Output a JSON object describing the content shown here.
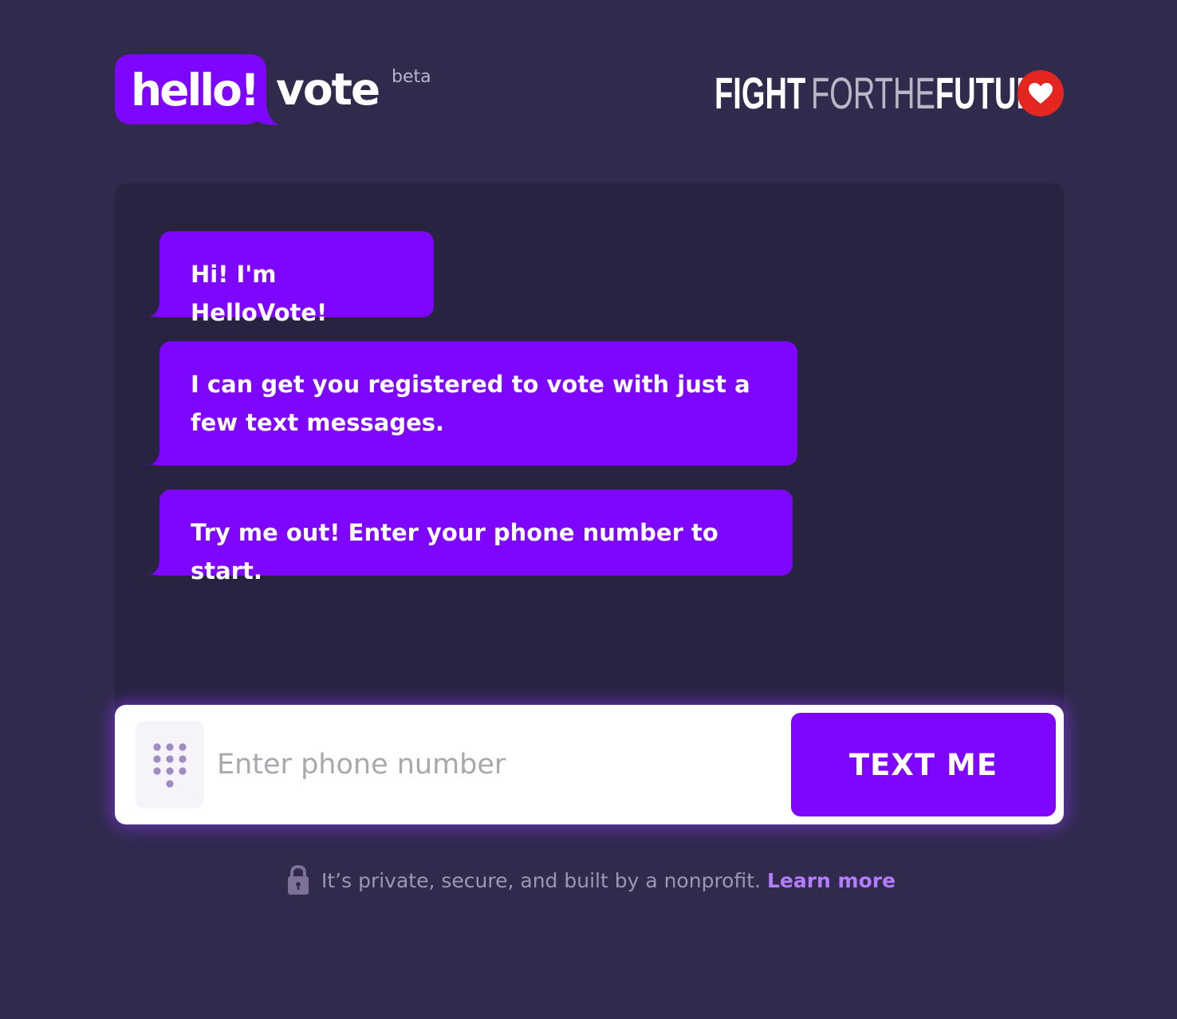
{
  "header": {
    "logo_hello": "hello!",
    "logo_vote": "vote",
    "logo_badge": "beta",
    "partner": {
      "word1": "FIGHT",
      "word2": "FORTHE",
      "word3": "FUTURE",
      "icon": "heart-icon"
    }
  },
  "chat": {
    "messages": [
      {
        "text": "Hi! I'm HelloVote!"
      },
      {
        "text": "I can get you registered to vote with just a few text messages."
      },
      {
        "text": "Try me out! Enter your phone number to start."
      }
    ]
  },
  "signup": {
    "keypad_icon": "keypad-icon",
    "phone_placeholder": "Enter phone number",
    "phone_value": "",
    "submit_label": "TEXT ME"
  },
  "footer": {
    "lock_icon": "lock-icon",
    "privacy_text": "It’s private, secure, and built by a nonprofit.",
    "learn_more": "Learn more"
  },
  "colors": {
    "page_background": "#302a4d",
    "chat_background": "#272341",
    "accent_purple": "#7e05fe",
    "link_purple": "#b47cff",
    "heart_red": "#e52620"
  }
}
